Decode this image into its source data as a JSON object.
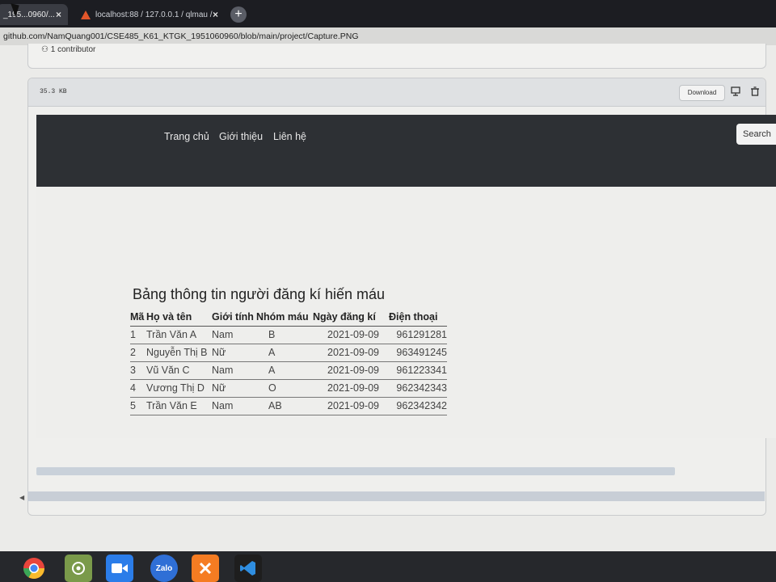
{
  "browser": {
    "tabs": [
      {
        "label": "_195...0960/...",
        "close": "×"
      },
      {
        "label": "localhost:88 / 127.0.0.1 / qlmau /",
        "close": "×"
      }
    ],
    "new_tab": "+",
    "url": "github.com/NamQuang001/CSE485_K61_KTGK_1951060960/blob/main/project/Capture.PNG"
  },
  "repo": {
    "contributors": "1 contributor"
  },
  "file": {
    "size": "35.3 KB",
    "download_label": "Download"
  },
  "screenshot": {
    "nav": [
      "Trang chủ",
      "Giới thiệu",
      "Liên hệ"
    ],
    "search_label": "Search",
    "table_title": "Bảng thông tin người đăng kí hiến máu",
    "columns": [
      "Mã",
      "Họ và tên",
      "Giới tính",
      "Nhóm máu",
      "Ngày đăng kí",
      "Điện thoại"
    ],
    "rows": [
      {
        "id": "1",
        "name": "Trần Văn A",
        "gender": "Nam",
        "blood": "B",
        "date": "2021-09-09",
        "phone": "961291281"
      },
      {
        "id": "2",
        "name": "Nguyễn Thị B",
        "gender": "Nữ",
        "blood": "A",
        "date": "2021-09-09",
        "phone": "963491245"
      },
      {
        "id": "3",
        "name": "Vũ Văn C",
        "gender": "Nam",
        "blood": "A",
        "date": "2021-09-09",
        "phone": "961223341"
      },
      {
        "id": "4",
        "name": "Vương Thị D",
        "gender": "Nữ",
        "blood": "O",
        "date": "2021-09-09",
        "phone": "962342343"
      },
      {
        "id": "5",
        "name": "Trần Văn E",
        "gender": "Nam",
        "blood": "AB",
        "date": "2021-09-09",
        "phone": "962342342"
      }
    ]
  },
  "taskbar": {
    "apps": [
      {
        "icon": "chrome-icon",
        "label": "",
        "color": "#e8453c"
      },
      {
        "icon": "settings-app-icon",
        "label": "",
        "color": "#7a9a4a"
      },
      {
        "icon": "video-app-icon",
        "label": "",
        "color": "#2b7de9"
      },
      {
        "icon": "zalo-icon",
        "label": "Zalo",
        "color": "#2f6fd6"
      },
      {
        "icon": "xampp-icon",
        "label": "",
        "color": "#f57c22"
      },
      {
        "icon": "vscode-icon",
        "label": "",
        "color": "#2478cc"
      }
    ]
  }
}
